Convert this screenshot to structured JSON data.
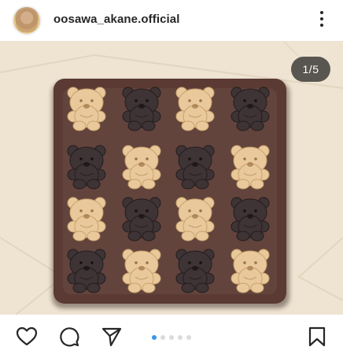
{
  "header": {
    "username": "oosawa_akane.official",
    "avatar_icon": "profile-avatar",
    "more_icon": "more-vertical-icon"
  },
  "photo": {
    "description_icon": "brownie-with-bear-cookies-photo",
    "page_counter": "1/5",
    "colors": {
      "parchment": "#efe4d2",
      "brownie": "#5a3a33",
      "light_cookie": "#e9c99b",
      "dark_cookie": "#3e3335"
    },
    "cookie_rows": [
      [
        "light",
        "dark",
        "light",
        "dark"
      ],
      [
        "dark",
        "light",
        "dark",
        "light"
      ],
      [
        "light",
        "dark",
        "light",
        "dark"
      ],
      [
        "dark",
        "light",
        "dark",
        "light"
      ]
    ]
  },
  "actions": {
    "like_icon": "heart-icon",
    "comment_icon": "comment-icon",
    "share_icon": "send-icon",
    "save_icon": "bookmark-icon",
    "carousel_total": 5,
    "carousel_current": 1,
    "active_dot_color": "#3897f0",
    "inactive_dot_color": "#dbdbdb"
  }
}
